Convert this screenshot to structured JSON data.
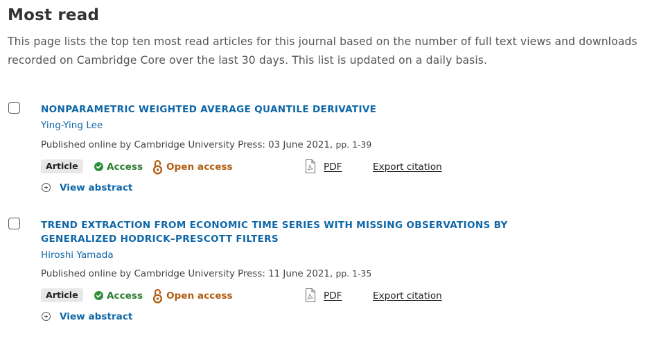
{
  "page": {
    "title": "Most read",
    "intro": "This page lists the top ten most read articles for this journal based on the number of full text views and downloads recorded on Cambridge Core over the last 30 days. This list is updated on a daily basis."
  },
  "articles": [
    {
      "title": "NONPARAMETRIC WEIGHTED AVERAGE QUANTILE DERIVATIVE",
      "author": "Ying-Ying Lee",
      "published": "Published online by Cambridge University Press: 03 June 2021,",
      "pages": "pp. 1-39",
      "type": "Article",
      "access": "Access",
      "open_access": "Open access",
      "pdf": "PDF",
      "export": "Export citation",
      "view_abstract": "View abstract"
    },
    {
      "title": "TREND EXTRACTION FROM ECONOMIC TIME SERIES WITH MISSING OBSERVATIONS BY GENERALIZED HODRICK–PRESCOTT FILTERS",
      "author": "Hiroshi Yamada",
      "published": "Published online by Cambridge University Press: 11 June 2021,",
      "pages": "pp. 1-35",
      "type": "Article",
      "access": "Access",
      "open_access": "Open access",
      "pdf": "PDF",
      "export": "Export citation",
      "view_abstract": "View abstract"
    }
  ],
  "icons": {
    "checkbox": "checkbox-icon",
    "access": "check-circle-icon",
    "open_access": "open-access-lock-icon",
    "pdf": "pdf-file-icon",
    "abstract": "plus-circle-icon"
  },
  "colors": {
    "link": "#0e67a8",
    "access": "#2e8f3a",
    "open_access": "#b35d12",
    "badge_bg": "#e8e8e8",
    "text": "#333333"
  }
}
